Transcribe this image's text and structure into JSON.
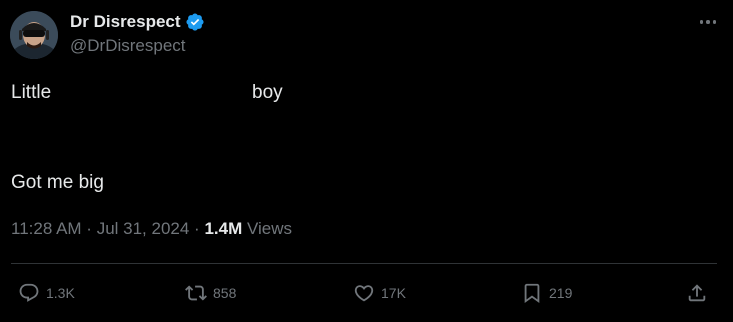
{
  "author": {
    "display_name": "Dr Disrespect",
    "handle": "@DrDisrespect",
    "verified": true
  },
  "tweet": {
    "text_line1_start": "Little",
    "text_line1_end": "boy",
    "text_line2": "Got me big"
  },
  "meta": {
    "time": "11:28 AM",
    "separator1": " · ",
    "date": "Jul 31, 2024",
    "separator2": " · ",
    "views_count": "1.4M",
    "views_label": " Views"
  },
  "actions": {
    "replies": "1.3K",
    "reposts": "858",
    "likes": "17K",
    "bookmarks": "219"
  },
  "colors": {
    "background": "#000000",
    "primary_text": "#e7e9ea",
    "secondary_text": "#71767b",
    "verified_badge": "#1d9bf0",
    "divider": "#2f3336"
  },
  "icons": {
    "more": "more-horizontal-icon",
    "reply": "reply-icon",
    "repost": "repost-icon",
    "like": "heart-icon",
    "bookmark": "bookmark-icon",
    "share": "share-icon",
    "verified": "verified-badge-icon"
  }
}
